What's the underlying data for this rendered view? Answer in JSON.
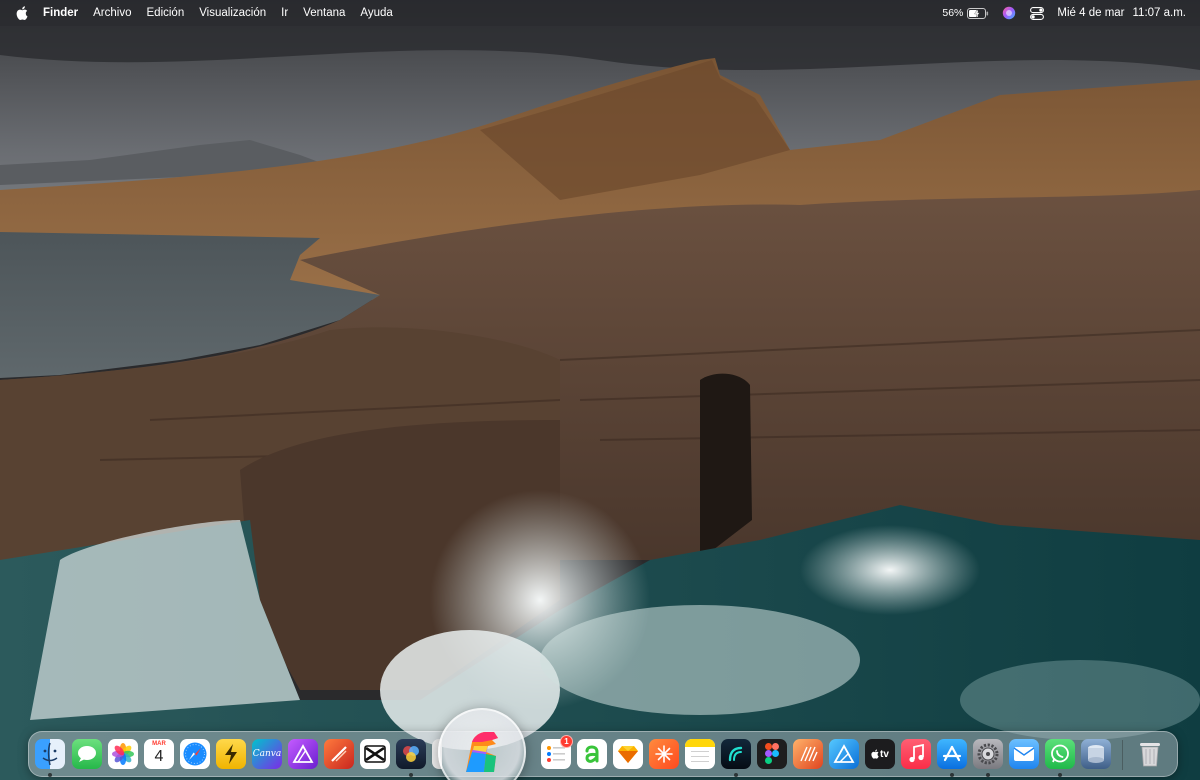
{
  "menubar": {
    "app_name": "Finder",
    "items": [
      "Archivo",
      "Edición",
      "Visualización",
      "Ir",
      "Ventana",
      "Ayuda"
    ],
    "battery_percent": "56%",
    "date": "Mié 4 de mar",
    "time": "11:07 a.m.",
    "icons": [
      "apple-icon",
      "battery-icon",
      "siri-icon",
      "control-center-icon"
    ]
  },
  "dock": {
    "calendar": {
      "month": "MAR",
      "day": "4"
    },
    "canva_label": "Canva",
    "appletv_label": "tv",
    "reminders_badge": "1",
    "items": [
      {
        "name": "finder",
        "color": "#1e7cf2"
      },
      {
        "name": "messages",
        "color": "#34c759"
      },
      {
        "name": "photos",
        "color": "#ffffff"
      },
      {
        "name": "calendar",
        "color": "#ffffff"
      },
      {
        "name": "safari",
        "color": "#1a8cff"
      },
      {
        "name": "reeder",
        "color": "#f5c400"
      },
      {
        "name": "canva",
        "color": "#7d2ae8"
      },
      {
        "name": "affinity-publisher",
        "color": "#9b3cf0"
      },
      {
        "name": "pdf-app",
        "color": "#e8442b"
      },
      {
        "name": "capcut",
        "color": "#ffffff"
      },
      {
        "name": "davinci-resolve",
        "color": "#1a2a40"
      },
      {
        "name": "launcher-magnified",
        "color": "#e9eaee"
      },
      {
        "name": "reminders",
        "color": "#ffffff"
      },
      {
        "name": "affinity-a",
        "color": "#ffffff"
      },
      {
        "name": "sketch",
        "color": "#ffffff"
      },
      {
        "name": "spark",
        "color": "#ff5a1f"
      },
      {
        "name": "notes",
        "color": "#ffffff"
      },
      {
        "name": "camo",
        "color": "#0c1a26"
      },
      {
        "name": "figma",
        "color": "#1e1e1e"
      },
      {
        "name": "affinity-photo",
        "color": "#ff7a3d"
      },
      {
        "name": "affinity-designer",
        "color": "#1a9fff"
      },
      {
        "name": "apple-tv",
        "color": "#1c1c1e"
      },
      {
        "name": "music",
        "color": "#fa2d48"
      },
      {
        "name": "app-store",
        "color": "#1a8cff"
      },
      {
        "name": "system-settings",
        "color": "#8e8e93"
      },
      {
        "name": "mail",
        "color": "#3ea2ff"
      },
      {
        "name": "whatsapp",
        "color": "#25d366"
      },
      {
        "name": "disk-utility",
        "color": "#4a6e9a"
      },
      {
        "name": "trash",
        "color": "#d6d6d8"
      }
    ]
  }
}
